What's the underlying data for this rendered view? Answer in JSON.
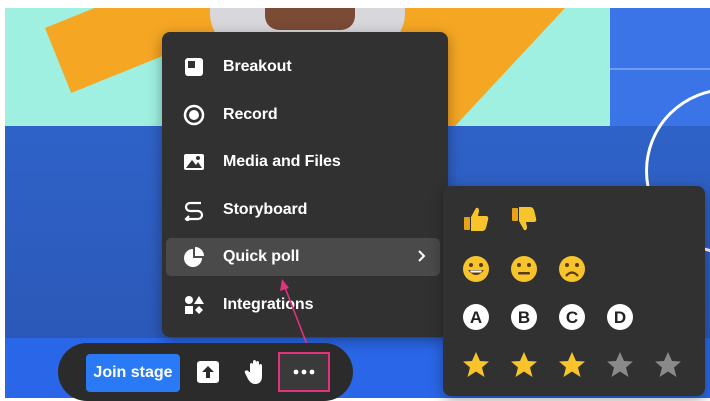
{
  "menu": {
    "items": [
      {
        "label": "Breakout",
        "icon": "breakout-icon"
      },
      {
        "label": "Record",
        "icon": "record-icon"
      },
      {
        "label": "Media and Files",
        "icon": "image-icon"
      },
      {
        "label": "Storyboard",
        "icon": "storyboard-icon"
      },
      {
        "label": "Quick poll",
        "icon": "pie-chart-icon",
        "active": true,
        "submenu": true
      },
      {
        "label": "Integrations",
        "icon": "shapes-icon"
      }
    ]
  },
  "poll_panel": {
    "rows": [
      [
        "thumbs-up",
        "thumbs-down"
      ],
      [
        "grinning-face",
        "neutral-face",
        "frowning-face"
      ],
      [
        "A",
        "B",
        "C",
        "D"
      ],
      [
        "star-filled",
        "star-filled",
        "star-filled",
        "star-empty",
        "star-empty"
      ]
    ]
  },
  "toolbar": {
    "join_label": "Join stage",
    "share_icon": "upload-icon",
    "hand_icon": "raise-hand-icon",
    "more_icon": "more-dots-icon"
  },
  "colors": {
    "menu_bg": "#313131",
    "accent_blue": "#2a7af5",
    "highlight_pink": "#e4317b",
    "star_gold": "#f7c52b",
    "star_grey": "#8a8a8a"
  }
}
